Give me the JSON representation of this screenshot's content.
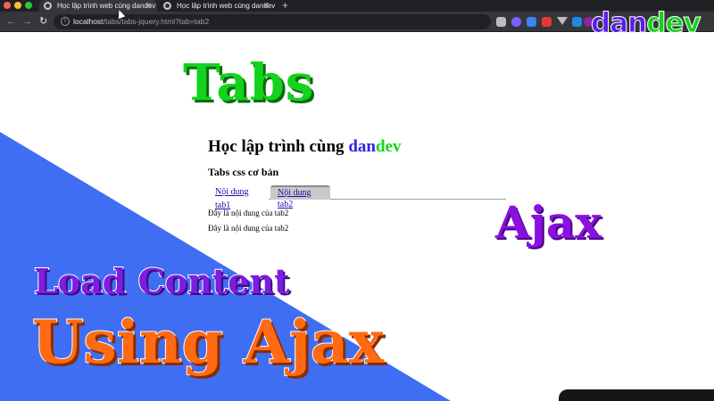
{
  "browser": {
    "tabs": [
      {
        "title": "Học lập trình web cùng dandev",
        "active": true
      },
      {
        "title": "Học lập trình web cùng dandev",
        "active": false
      }
    ],
    "url_host": "localhost",
    "url_path": "/tabs/tabs-jquery.html?tab=tab2"
  },
  "logo": {
    "part1": "dan",
    "part2": "dev",
    "color1": "#5a1de6",
    "color2": "#13d31c"
  },
  "overlay": {
    "tabs_word": "Tabs",
    "ajax_word": "Ajax",
    "load_content": "Load Content",
    "using_ajax": "Using Ajax"
  },
  "page": {
    "title_prefix": "Học lập trình cùng ",
    "title_dan": "dan",
    "title_dev": "dev",
    "section_title": "Tabs css cơ bản",
    "tabs": [
      {
        "label": "Nội dung tab1",
        "active": false
      },
      {
        "label": "Nội dung tab2",
        "active": true
      }
    ],
    "content_lines": [
      "Đây là nội dung của tab2",
      "Đây là nội dung của tab2"
    ]
  },
  "colors": {
    "blue_panel": "#3f6ef3",
    "green": "#13d31c",
    "purple": "#8a10e0",
    "orange": "#ff6a13"
  }
}
